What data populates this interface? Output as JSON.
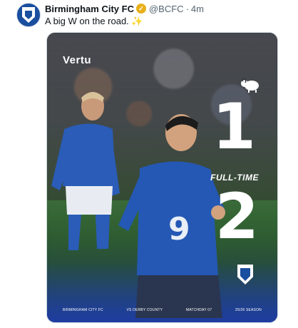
{
  "account": {
    "name": "Birmingham City FC",
    "handle": "@BCFC",
    "separator": "·",
    "time": "4m",
    "avatar_icon": "bcfc-crest-icon",
    "verified_icon": "verified-badge-icon",
    "verified_color": "#e8b01d"
  },
  "tweet": {
    "text": "A big W on the road.",
    "emoji": "✨"
  },
  "media": {
    "sponsor": "Vertu",
    "opponent_crest_icon": "derby-ram-icon",
    "home_crest_icon": "bcfc-crest-icon",
    "opponent_score": "1",
    "status": "FULL-TIME",
    "home_score": "2",
    "footer": {
      "team": "BIRMINGHAM CITY FC",
      "fixture": "VS DERBY COUNTY",
      "matchday": "MATCHDAY 07",
      "season": "25/26 SEASON"
    },
    "accent_color": "#1a4e9e"
  }
}
